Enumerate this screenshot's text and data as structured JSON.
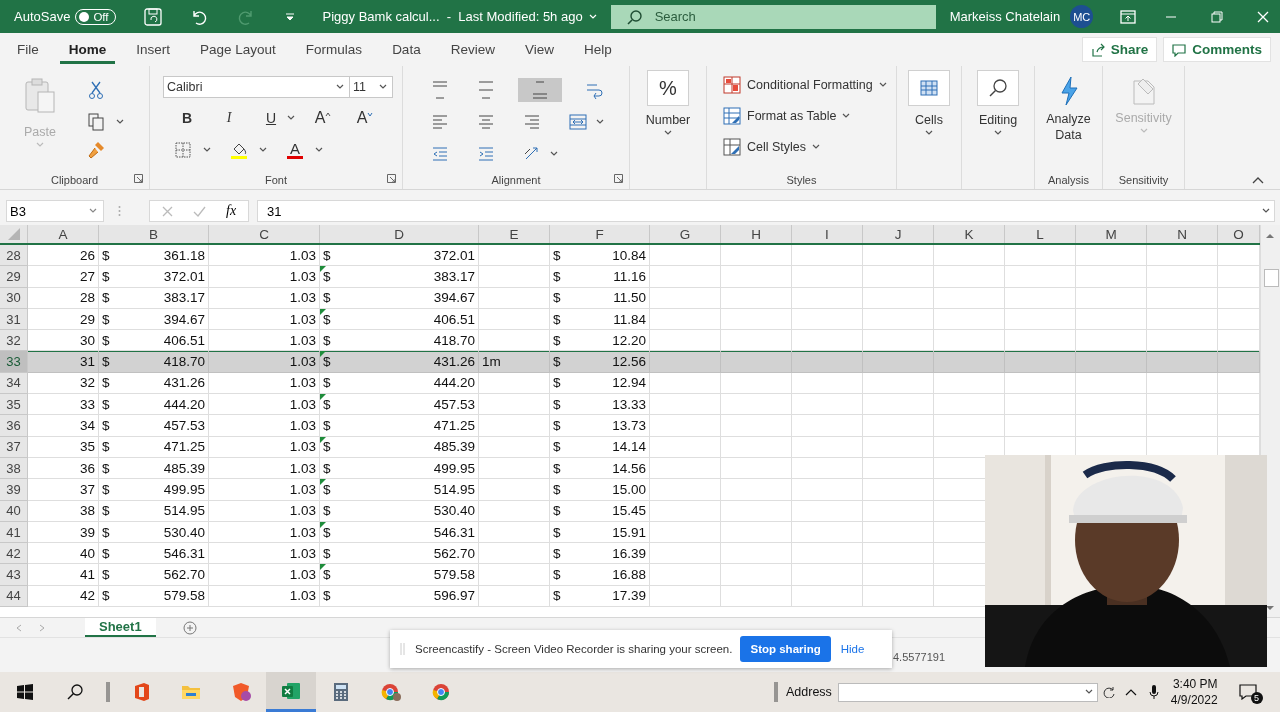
{
  "titlebar": {
    "autosave_label": "AutoSave",
    "autosave": {
      "on": false,
      "label": "Off"
    },
    "document_title": "Piggy Bamk calcul...  -  Last Modified: 5h ago",
    "search": {
      "placeholder": "Search"
    },
    "user_name": "Markeiss Chatelain",
    "avatar": "MC"
  },
  "tabs": [
    {
      "label": "File",
      "selected": false
    },
    {
      "label": "Home",
      "selected": true
    },
    {
      "label": "Insert",
      "selected": false
    },
    {
      "label": "Page Layout",
      "selected": false
    },
    {
      "label": "Formulas",
      "selected": false
    },
    {
      "label": "Data",
      "selected": false
    },
    {
      "label": "Review",
      "selected": false
    },
    {
      "label": "View",
      "selected": false
    },
    {
      "label": "Help",
      "selected": false
    }
  ],
  "share_button": "Share",
  "comments_button": "Comments",
  "ribbon": {
    "groups": [
      {
        "kind": "clipboard",
        "label": "Clipboard",
        "paste": {
          "label": "Paste",
          "disabled": true
        }
      },
      {
        "kind": "font",
        "label": "Font",
        "font": "Calibri",
        "size": "11",
        "bold": "B",
        "italic": "I",
        "underline": "U",
        "grow": "A",
        "shrink": "A",
        "font_color": "A"
      },
      {
        "kind": "alignment",
        "label": "Alignment",
        "buttons": [
          {
            "kind": "top",
            "selected": false
          },
          {
            "kind": "middle",
            "selected": false
          },
          {
            "kind": "bottom",
            "selected": true
          },
          {
            "kind": "wrap",
            "selected": false
          },
          {
            "kind": "left",
            "selected": false
          },
          {
            "kind": "center",
            "selected": false
          },
          {
            "kind": "right",
            "selected": false
          },
          {
            "kind": "merge",
            "selected": false
          },
          {
            "kind": "outdent",
            "selected": false
          },
          {
            "kind": "indent",
            "selected": false
          },
          {
            "kind": "orientation",
            "selected": false
          }
        ]
      },
      {
        "kind": "number",
        "button": "Number",
        "symbol": "%"
      },
      {
        "kind": "styles",
        "label": "Styles",
        "items": [
          "Conditional Formatting",
          "Format as Table",
          "Cell Styles"
        ]
      },
      {
        "kind": "cells",
        "button": "Cells"
      },
      {
        "kind": "editing",
        "button": "Editing"
      },
      {
        "kind": "analysis",
        "label": "Analysis",
        "button": "Analyze Data"
      },
      {
        "kind": "sensitivity",
        "label": "Sensitivity",
        "button": "Sensitivity",
        "disabled": true
      }
    ]
  },
  "formula_bar": {
    "name_box": "B3",
    "fx": "fx",
    "value": "31"
  },
  "columns": [
    "A",
    "B",
    "C",
    "D",
    "E",
    "F",
    "G",
    "H",
    "I",
    "J",
    "K",
    "L",
    "M",
    "N",
    "O"
  ],
  "rows": [
    {
      "header": "28",
      "a": "26",
      "b": [
        "$",
        "361.18"
      ],
      "c": "1.03",
      "d": [
        "$",
        "372.01"
      ],
      "f": [
        "$",
        "10.84"
      ],
      "flagged": false,
      "selected": false
    },
    {
      "header": "29",
      "a": "27",
      "b": [
        "$",
        "372.01"
      ],
      "c": "1.03",
      "d": [
        "$",
        "383.17"
      ],
      "f": [
        "$",
        "11.16"
      ],
      "flagged": true,
      "selected": false
    },
    {
      "header": "30",
      "a": "28",
      "b": [
        "$",
        "383.17"
      ],
      "c": "1.03",
      "d": [
        "$",
        "394.67"
      ],
      "f": [
        "$",
        "11.50"
      ],
      "flagged": false,
      "selected": false
    },
    {
      "header": "31",
      "a": "29",
      "b": [
        "$",
        "394.67"
      ],
      "c": "1.03",
      "d": [
        "$",
        "406.51"
      ],
      "f": [
        "$",
        "11.84"
      ],
      "flagged": true,
      "selected": false
    },
    {
      "header": "32",
      "a": "30",
      "b": [
        "$",
        "406.51"
      ],
      "c": "1.03",
      "d": [
        "$",
        "418.70"
      ],
      "f": [
        "$",
        "12.20"
      ],
      "flagged": false,
      "selected": false
    },
    {
      "header": "33",
      "a": "31",
      "b": [
        "$",
        "418.70"
      ],
      "c": "1.03",
      "d": [
        "$",
        "431.26"
      ],
      "e": "1m",
      "f": [
        "$",
        "12.56"
      ],
      "flagged": true,
      "selected": true
    },
    {
      "header": "34",
      "a": "32",
      "b": [
        "$",
        "431.26"
      ],
      "c": "1.03",
      "d": [
        "$",
        "444.20"
      ],
      "f": [
        "$",
        "12.94"
      ],
      "flagged": false,
      "selected": false
    },
    {
      "header": "35",
      "a": "33",
      "b": [
        "$",
        "444.20"
      ],
      "c": "1.03",
      "d": [
        "$",
        "457.53"
      ],
      "f": [
        "$",
        "13.33"
      ],
      "flagged": true,
      "selected": false
    },
    {
      "header": "36",
      "a": "34",
      "b": [
        "$",
        "457.53"
      ],
      "c": "1.03",
      "d": [
        "$",
        "471.25"
      ],
      "f": [
        "$",
        "13.73"
      ],
      "flagged": false,
      "selected": false
    },
    {
      "header": "37",
      "a": "35",
      "b": [
        "$",
        "471.25"
      ],
      "c": "1.03",
      "d": [
        "$",
        "485.39"
      ],
      "f": [
        "$",
        "14.14"
      ],
      "flagged": true,
      "selected": false
    },
    {
      "header": "38",
      "a": "36",
      "b": [
        "$",
        "485.39"
      ],
      "c": "1.03",
      "d": [
        "$",
        "499.95"
      ],
      "f": [
        "$",
        "14.56"
      ],
      "flagged": false,
      "selected": false
    },
    {
      "header": "39",
      "a": "37",
      "b": [
        "$",
        "499.95"
      ],
      "c": "1.03",
      "d": [
        "$",
        "514.95"
      ],
      "f": [
        "$",
        "15.00"
      ],
      "flagged": true,
      "selected": false
    },
    {
      "header": "40",
      "a": "38",
      "b": [
        "$",
        "514.95"
      ],
      "c": "1.03",
      "d": [
        "$",
        "530.40"
      ],
      "f": [
        "$",
        "15.45"
      ],
      "flagged": false,
      "selected": false
    },
    {
      "header": "41",
      "a": "39",
      "b": [
        "$",
        "530.40"
      ],
      "c": "1.03",
      "d": [
        "$",
        "546.31"
      ],
      "f": [
        "$",
        "15.91"
      ],
      "flagged": true,
      "selected": false
    },
    {
      "header": "42",
      "a": "40",
      "b": [
        "$",
        "546.31"
      ],
      "c": "1.03",
      "d": [
        "$",
        "562.70"
      ],
      "f": [
        "$",
        "16.39"
      ],
      "flagged": false,
      "selected": false
    },
    {
      "header": "43",
      "a": "41",
      "b": [
        "$",
        "562.70"
      ],
      "c": "1.03",
      "d": [
        "$",
        "579.58"
      ],
      "f": [
        "$",
        "16.88"
      ],
      "flagged": true,
      "selected": false
    },
    {
      "header": "44",
      "a": "42",
      "b": [
        "$",
        "579.58"
      ],
      "c": "1.03",
      "d": [
        "$",
        "596.97"
      ],
      "f": [
        "$",
        "17.39"
      ],
      "flagged": false,
      "selected": false
    }
  ],
  "sheets": [
    {
      "label": "Sheet1",
      "selected": true
    }
  ],
  "status_bar": {
    "reading": "4.5577191"
  },
  "banner": {
    "message": "Screencastify - Screen Video Recorder is sharing your screen.",
    "stop_button": "Stop sharing",
    "hide_link": "Hide"
  },
  "taskbar": {
    "address_label": "Address",
    "time": "3:40 PM",
    "date": "4/9/2022",
    "notifications": "5"
  }
}
